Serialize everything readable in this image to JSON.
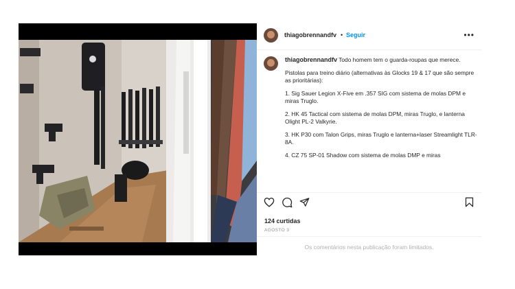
{
  "post": {
    "username": "thiagobrennandfv",
    "separator": "•",
    "follow_label": "Seguir",
    "more_label": "•••",
    "caption_intro": "Todo homem tem o guarda-roupas que merece.",
    "caption_paragraphs": [
      "Pistolas para treino diário (alternativas às Glocks 19 & 17 que são sempre as prioritárias):",
      "1. Sig Sauer Legion X-Five em .357 SIG com sistema de molas DPM e miras Truglo.",
      "2. HK 45 Tactical com sistema de molas DPM, miras Truglo, e lanterna Olight PL-2 Valkyrie.",
      "3. HK P30 com Talon Grips, miras Truglo e lanterna+laser Streamlight TLR-8A.",
      "4. CZ 75 SP-01 Shadow com sistema de molas DMP e miras"
    ],
    "likes": "124 curtidas",
    "date": "AGOSTO 3",
    "comments_limited": "Os comentários nesta publicação foram limitados."
  },
  "icons": {
    "like": "heart-icon",
    "comment": "comment-icon",
    "share": "share-icon",
    "save": "bookmark-icon",
    "more": "more-options-icon"
  },
  "colors": {
    "follow": "#0095f6",
    "text": "#262626",
    "muted": "#8e8e8e",
    "border": "#efefef"
  }
}
